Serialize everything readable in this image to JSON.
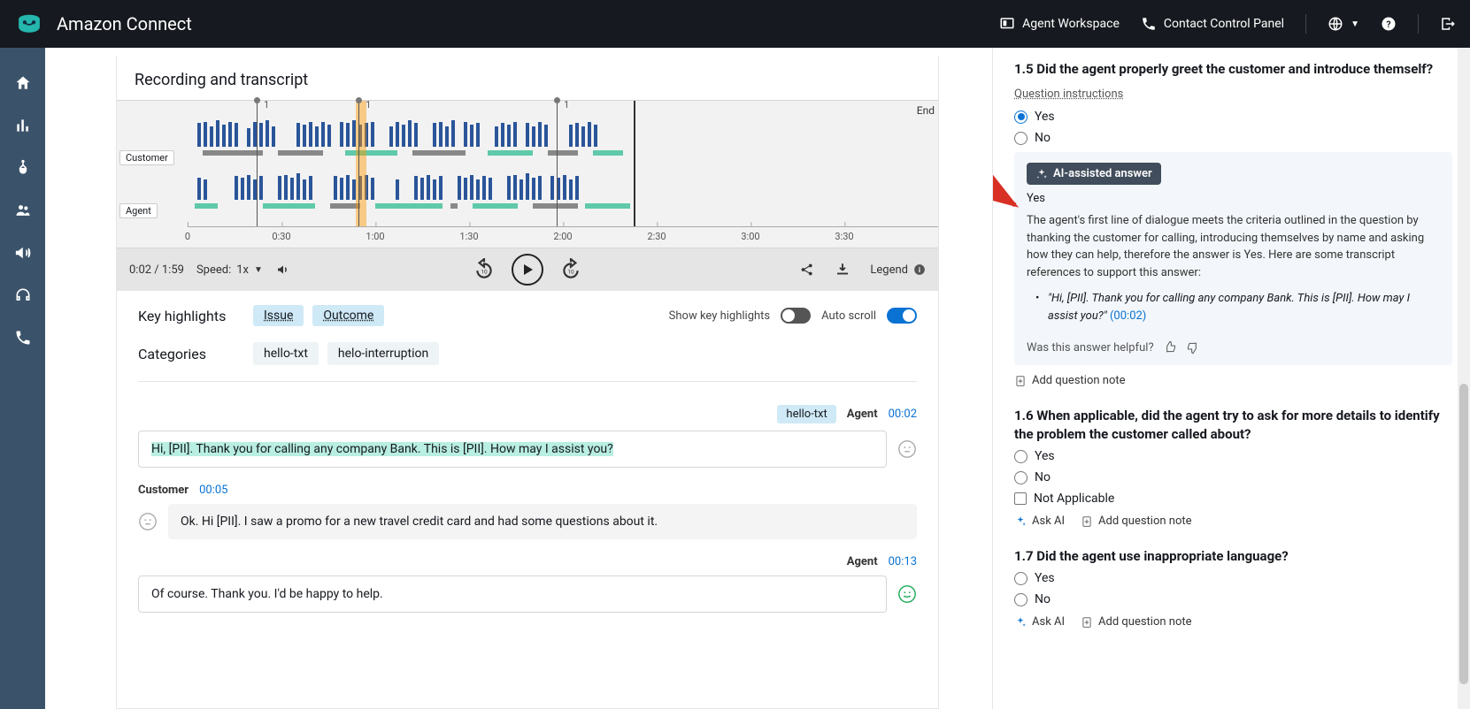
{
  "header": {
    "product": "Amazon Connect",
    "agentWorkspace": "Agent Workspace",
    "ccp": "Contact Control Panel"
  },
  "recording": {
    "sectionTitle": "Recording and transcript",
    "customerLabel": "Customer",
    "agentLabel": "Agent",
    "endLabel": "End",
    "markers": [
      "1",
      "1",
      "1"
    ],
    "ticks": [
      "0",
      "0:30",
      "1:00",
      "1:30",
      "2:00",
      "2:30",
      "3:00",
      "3:30"
    ]
  },
  "player": {
    "time": "0:02 / 1:59",
    "speedLabel": "Speed:",
    "speedValue": "1x",
    "legend": "Legend"
  },
  "highlights": {
    "title": "Key highlights",
    "issueChip": "Issue",
    "outcomeChip": "Outcome",
    "showLabel": "Show key highlights",
    "autoScroll": "Auto scroll",
    "categoriesTitle": "Categories",
    "cats": [
      "hello-txt",
      "helo-interruption"
    ]
  },
  "transcript": {
    "m1": {
      "tag": "hello-txt",
      "speaker": "Agent",
      "time": "00:02",
      "text": "Hi, [PII]. Thank you for calling any company Bank. This is [PII]. How may I assist you?"
    },
    "m2": {
      "speaker": "Customer",
      "time": "00:05",
      "text": "Ok. Hi [PII]. I saw a promo for a new travel credit card and had some questions about it."
    },
    "m3": {
      "speaker": "Agent",
      "time": "00:13",
      "text": "Of course. Thank you. I'd be happy to help."
    }
  },
  "eval": {
    "q15": {
      "title": "1.5 Did the agent properly greet the customer and introduce themself?",
      "instructions": "Question instructions",
      "opts": {
        "yes": "Yes",
        "no": "No"
      },
      "aiBadge": "AI-assisted answer",
      "aiAnswer": "Yes",
      "aiText": "The agent's first line of dialogue meets the criteria outlined in the question by thanking the customer for calling, introducing themselves by name and asking how they can help, therefore the answer is Yes. Here are some transcript references to support this answer:",
      "aiQuote": "\"Hi, [PII]. Thank you for calling any company Bank. This is [PII]. How may I assist you?\" ",
      "aiTs": "(00:02)",
      "feedback": "Was this answer helpful?",
      "addNote": "Add question note"
    },
    "q16": {
      "title": "1.6 When applicable, did the agent try to ask for more details to identify the problem the customer called about?",
      "opts": {
        "yes": "Yes",
        "no": "No",
        "na": "Not Applicable"
      },
      "askAi": "Ask AI",
      "addNote": "Add question note"
    },
    "q17": {
      "title": "1.7 Did the agent use inappropriate language?",
      "opts": {
        "yes": "Yes",
        "no": "No"
      },
      "askAi": "Ask AI",
      "addNote": "Add question note"
    }
  }
}
